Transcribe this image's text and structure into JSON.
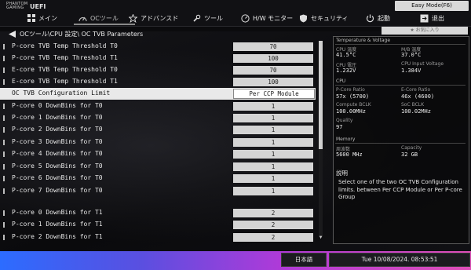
{
  "header": {
    "logo_line1": "PHANTOM",
    "logo_line2": "GAMING",
    "logo_uefi": "UEFI",
    "easy_mode": "Easy Mode(F6)",
    "tabs": [
      {
        "label": "メイン",
        "icon": "menu-grid-icon"
      },
      {
        "label": "OCツール",
        "icon": "speedometer-icon",
        "active": true
      },
      {
        "label": "アドバンスド",
        "icon": "star-icon"
      },
      {
        "label": "ツール",
        "icon": "wrench-icon"
      },
      {
        "label": "H/W モニター",
        "icon": "monitor-icon"
      },
      {
        "label": "セキュリティ",
        "icon": "shield-icon"
      },
      {
        "label": "起動",
        "icon": "power-icon"
      },
      {
        "label": "退出",
        "icon": "exit-icon"
      }
    ]
  },
  "breadcrumb": "OCツール\\CPU 設定\\ OC TVB Parameters",
  "favorite_label": "★ お気に入り",
  "settings": [
    {
      "label": "P-core TVB Temp Threshold T0",
      "value": "70"
    },
    {
      "label": "P-core TVB Temp Threshold T1",
      "value": "100"
    },
    {
      "label": "E-core TVB Temp Threshold T0",
      "value": "70"
    },
    {
      "label": "E-core TVB Temp Threshold T1",
      "value": "100"
    },
    {
      "label": "OC TVB Configuration Limit",
      "value": "Per CCP Module",
      "selected": true
    },
    {
      "label": "P-core 0 DownBins for T0",
      "value": "1"
    },
    {
      "label": "P-core 1 DownBins for T0",
      "value": "1"
    },
    {
      "label": "P-core 2 DownBins for T0",
      "value": "1"
    },
    {
      "label": "P-core 3 DownBins for T0",
      "value": "1"
    },
    {
      "label": "P-core 4 DownBins for T0",
      "value": "1"
    },
    {
      "label": "P-core 5 DownBins for T0",
      "value": "1"
    },
    {
      "label": "P-core 6 DownBins for T0",
      "value": "1"
    },
    {
      "label": "P-core 7 DownBins for T0",
      "value": "1"
    },
    {
      "label": "P-core 0 DownBins for T1",
      "value": "2"
    },
    {
      "label": "P-core 1 DownBins for T1",
      "value": "2"
    },
    {
      "label": "P-core 2 DownBins for T1",
      "value": "2"
    }
  ],
  "panel": {
    "temp_voltage": {
      "title": "Temperature & Voltage",
      "cpu_temp_label": "CPU 温度",
      "cpu_temp": "41.5°C",
      "mb_temp_label": "M/B 温度",
      "mb_temp": "37.0°C",
      "cpu_volt_label": "CPU 電圧",
      "cpu_volt": "1.232V",
      "cpu_input_label": "CPU Input Voltage",
      "cpu_input": "1.384V"
    },
    "cpu": {
      "title": "CPU",
      "pcore_ratio_label": "P-Core Ratio",
      "pcore_ratio": "57x (5700)",
      "ecore_ratio_label": "E-Core Ratio",
      "ecore_ratio": "46x (4600)",
      "compute_bclk_label": "Compute BCLK",
      "compute_bclk": "100.00MHz",
      "soc_bclk_label": "SoC BCLK",
      "soc_bclk": "100.02MHz",
      "quality_label": "Quality",
      "quality": "97"
    },
    "memory": {
      "title": "Memory",
      "freq_label": "周波数",
      "freq": "5600 MHz",
      "capacity_label": "Capacity",
      "capacity": "32 GB"
    },
    "description_title": "説明",
    "description": "Select one of the two OC TVB Configuration limits. between Per CCP Module or Per P-core Group"
  },
  "footer": {
    "language": "日本語",
    "datetime": "Tue 10/08/2024. 08:53:51"
  }
}
